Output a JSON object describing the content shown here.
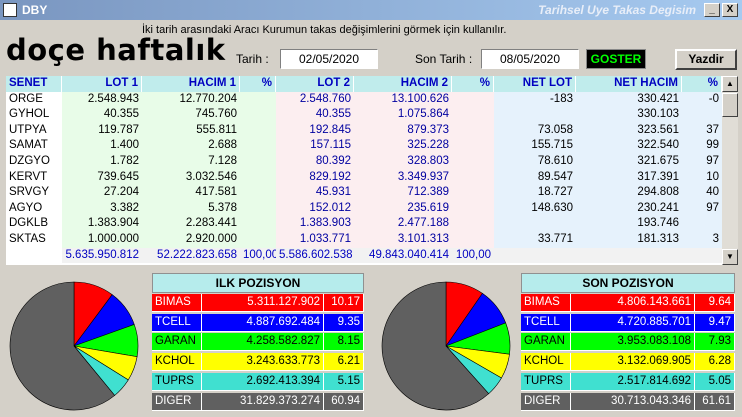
{
  "window": {
    "app_name": "DBY",
    "title": "Tarihsel Uye Takas Degisim",
    "min_label": "_",
    "close_label": "X"
  },
  "overlay_text": "doçe haftalık",
  "info_text": "İki tarih arasındaki  Aracı Kurumun takas değişimlerini görmek için kullanılır.",
  "form": {
    "start_label": "Tarih :",
    "start_value": "02/05/2020",
    "end_label": "Son Tarih :",
    "end_value": "08/05/2020",
    "show_button": "GOSTER",
    "print_button": "Yazdir"
  },
  "table": {
    "headers": [
      "SENET",
      "LOT 1",
      "HACIM 1",
      "%",
      "LOT 2",
      "HACIM 2",
      "%",
      "NET LOT",
      "NET HACIM",
      "%"
    ],
    "rows": [
      [
        "ORGE",
        "2.548.943",
        "12.770.204",
        "",
        "2.548.760",
        "13.100.626",
        "",
        "-183",
        "330.421",
        "-0"
      ],
      [
        "GYHOL",
        "40.355",
        "745.760",
        "",
        "40.355",
        "1.075.864",
        "",
        "",
        "330.103",
        ""
      ],
      [
        "UTPYA",
        "119.787",
        "555.811",
        "",
        "192.845",
        "879.373",
        "",
        "73.058",
        "323.561",
        "37"
      ],
      [
        "SAMAT",
        "1.400",
        "2.688",
        "",
        "157.115",
        "325.228",
        "",
        "155.715",
        "322.540",
        "99"
      ],
      [
        "DZGYO",
        "1.782",
        "7.128",
        "",
        "80.392",
        "328.803",
        "",
        "78.610",
        "321.675",
        "97"
      ],
      [
        "KERVT",
        "739.645",
        "3.032.546",
        "",
        "829.192",
        "3.349.937",
        "",
        "89.547",
        "317.391",
        "10"
      ],
      [
        "SRVGY",
        "27.204",
        "417.581",
        "",
        "45.931",
        "712.389",
        "",
        "18.727",
        "294.808",
        "40"
      ],
      [
        "AGYO",
        "3.382",
        "5.378",
        "",
        "152.012",
        "235.619",
        "",
        "148.630",
        "230.241",
        "97"
      ],
      [
        "DGKLB",
        "1.383.904",
        "2.283.441",
        "",
        "1.383.903",
        "2.477.188",
        "",
        "",
        "193.746",
        ""
      ],
      [
        "SKTAS",
        "1.000.000",
        "2.920.000",
        "",
        "1.033.771",
        "3.101.313",
        "",
        "33.771",
        "181.313",
        "3"
      ]
    ],
    "totals": [
      "",
      "5.635.950.812",
      "52.222.823.658",
      "100,00",
      "5.586.602.538",
      "49.843.040.414",
      "100,00",
      "",
      "",
      ""
    ]
  },
  "ilk_pozisyon": {
    "title": "ILK POZISYON",
    "rows": [
      {
        "name": "BIMAS",
        "value": "5.311.127.902",
        "pct": "10.17",
        "color": "#ff0000",
        "fg": "#ffffff",
        "share": 10.17
      },
      {
        "name": "TCELL",
        "value": "4.887.692.484",
        "pct": "9.35",
        "color": "#0000ff",
        "fg": "#ffffff",
        "share": 9.35
      },
      {
        "name": "GARAN",
        "value": "4.258.582.827",
        "pct": "8.15",
        "color": "#00ff00",
        "fg": "#000000",
        "share": 8.15
      },
      {
        "name": "KCHOL",
        "value": "3.243.633.773",
        "pct": "6.21",
        "color": "#ffff00",
        "fg": "#000000",
        "share": 6.21
      },
      {
        "name": "TUPRS",
        "value": "2.692.413.394",
        "pct": "5.15",
        "color": "#40e0d0",
        "fg": "#000000",
        "share": 5.15
      },
      {
        "name": "DIGER",
        "value": "31.829.373.274",
        "pct": "60.94",
        "color": "#606060",
        "fg": "#ffffff",
        "share": 60.94
      }
    ]
  },
  "son_pozisyon": {
    "title": "SON POZISYON",
    "rows": [
      {
        "name": "BIMAS",
        "value": "4.806.143.661",
        "pct": "9.64",
        "color": "#ff0000",
        "fg": "#ffffff",
        "share": 9.64
      },
      {
        "name": "TCELL",
        "value": "4.720.885.701",
        "pct": "9.47",
        "color": "#0000ff",
        "fg": "#ffffff",
        "share": 9.47
      },
      {
        "name": "GARAN",
        "value": "3.953.083.108",
        "pct": "7.93",
        "color": "#00ff00",
        "fg": "#000000",
        "share": 7.93
      },
      {
        "name": "KCHOL",
        "value": "3.132.069.905",
        "pct": "6.28",
        "color": "#ffff00",
        "fg": "#000000",
        "share": 6.28
      },
      {
        "name": "TUPRS",
        "value": "2.517.814.692",
        "pct": "5.05",
        "color": "#40e0d0",
        "fg": "#000000",
        "share": 5.05
      },
      {
        "name": "DIGER",
        "value": "30.713.043.346",
        "pct": "61.61",
        "color": "#606060",
        "fg": "#ffffff",
        "share": 61.61
      }
    ]
  }
}
